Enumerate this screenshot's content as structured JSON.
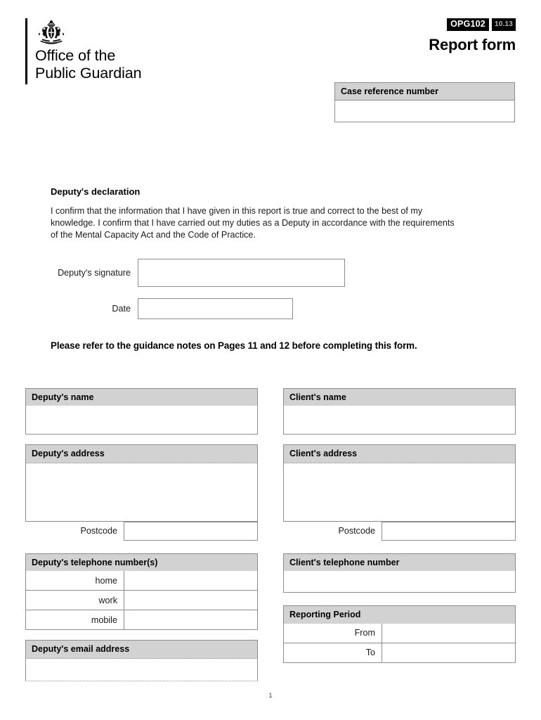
{
  "header": {
    "crest_icon": "royal-coat-of-arms-icon",
    "organisation": "Office of the\nPublic Guardian",
    "form_code": "OPG102",
    "form_version": "10.13",
    "title": "Report form"
  },
  "case_reference": {
    "label": "Case reference number",
    "value": ""
  },
  "declaration": {
    "title": "Deputy's declaration",
    "body": "I confirm that the information that I have given in this report is true and correct to the best of my knowledge. I confirm that I have carried out my duties as a Deputy in accordance with the requirements of the Mental Capacity Act and the Code of Practice.",
    "signature_label": "Deputy's signature",
    "signature_value": "",
    "date_label": "Date",
    "date_value": ""
  },
  "guidance_note": "Please refer to the guidance notes on Pages 11 and 12 before completing this form.",
  "left_column": {
    "name": {
      "label": "Deputy's name",
      "value": ""
    },
    "address": {
      "label": "Deputy's address",
      "value": "",
      "postcode_label": "Postcode",
      "postcode_value": ""
    },
    "telephone": {
      "label": "Deputy's telephone number(s)",
      "rows": [
        {
          "label": "home",
          "value": ""
        },
        {
          "label": "work",
          "value": ""
        },
        {
          "label": "mobile",
          "value": ""
        }
      ]
    },
    "email": {
      "label": "Deputy's email address",
      "value": ""
    }
  },
  "right_column": {
    "name": {
      "label": "Client's name",
      "value": ""
    },
    "address": {
      "label": "Client's address",
      "value": "",
      "postcode_label": "Postcode",
      "postcode_value": ""
    },
    "telephone": {
      "label": "Client's telephone number",
      "value": ""
    },
    "reporting_period": {
      "label": "Reporting Period",
      "rows": [
        {
          "label": "From",
          "value": ""
        },
        {
          "label": "To",
          "value": ""
        }
      ]
    }
  },
  "footer": {
    "page_number": "1"
  },
  "colors": {
    "band_gray": "#d2d2d2",
    "border_gray": "#8c8c8c",
    "badge_black": "#000000",
    "text": "#1a1a1a"
  }
}
